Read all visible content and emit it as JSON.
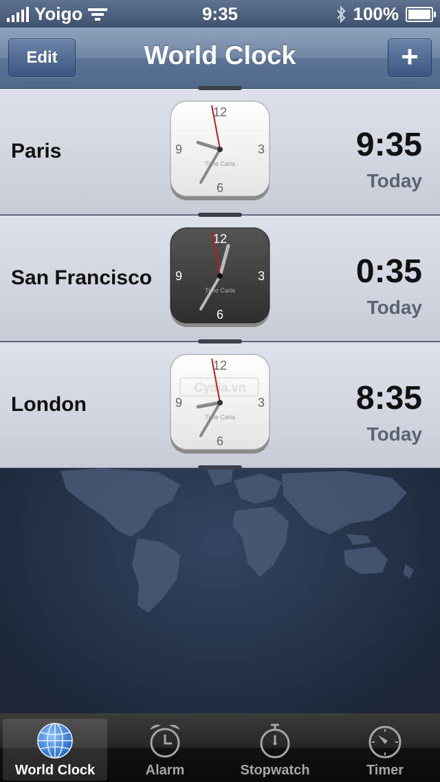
{
  "status_bar": {
    "carrier": "Yoigo",
    "time": "9:35",
    "battery": "100%"
  },
  "nav": {
    "edit_label": "Edit",
    "title": "World Clock",
    "add_label": "+"
  },
  "clock_brand": "Time Carla",
  "cities": [
    {
      "name": "Paris",
      "time": "9:35",
      "day": "Today",
      "theme": "light"
    },
    {
      "name": "San Francisco",
      "time": "0:35",
      "day": "Today",
      "theme": "dark"
    },
    {
      "name": "London",
      "time": "8:35",
      "day": "Today",
      "theme": "light"
    }
  ],
  "watermark": "Cydia.vn",
  "tabs": [
    {
      "label": "World Clock",
      "icon": "globe-icon",
      "active": true
    },
    {
      "label": "Alarm",
      "icon": "alarm-clock-icon",
      "active": false
    },
    {
      "label": "Stopwatch",
      "icon": "stopwatch-icon",
      "active": false
    },
    {
      "label": "Timer",
      "icon": "timer-icon",
      "active": false
    }
  ],
  "colors": {
    "accent_blue": "#4a8fe0",
    "second_hand": "#c01818"
  }
}
